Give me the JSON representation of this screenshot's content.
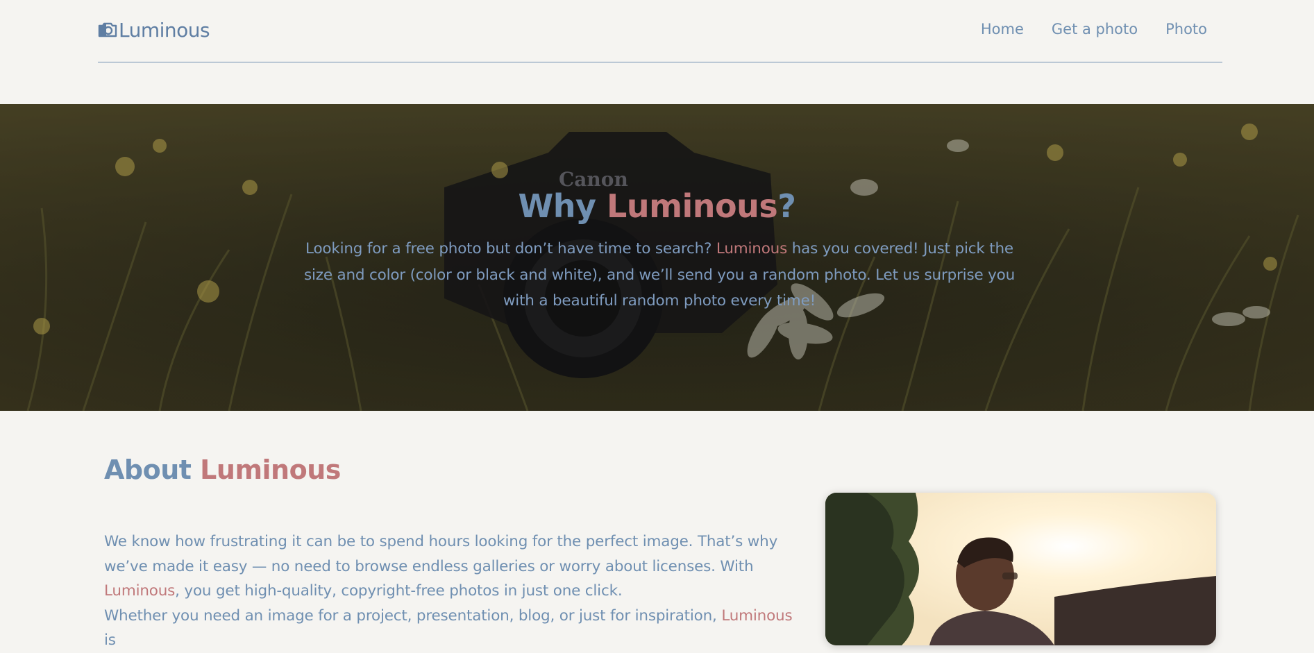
{
  "header": {
    "logo_text": "Luminous",
    "logo_icon": "camera-icon",
    "nav": [
      {
        "label": "Home"
      },
      {
        "label": "Get a photo"
      },
      {
        "label": "Photo"
      }
    ]
  },
  "hero": {
    "title_prefix": "Why ",
    "title_brand": "Luminous",
    "title_suffix": "?",
    "text_part1": "Looking for a free photo but don’t have time to search? ",
    "text_brand": "Luminous",
    "text_part2": " has you covered! Just pick the size and color (color or black and white), and we’ll send you a random photo. Let us surprise you with a beautiful random photo every time!"
  },
  "about": {
    "title_prefix": "About ",
    "title_brand": "Luminous",
    "para1_part1": "We know how frustrating it can be to spend hours looking for the perfect image. That’s why we’ve made it easy — no need to browse endless galleries or worry about licenses. With ",
    "para1_brand": "Luminous",
    "para1_part2": ", you get high-quality, copyright-free photos in just one click.",
    "para2_part1": "Whether you need an image for a project, presentation, blog, or just for inspiration, ",
    "para2_brand": "Luminous",
    "para2_part2": " is"
  },
  "colors": {
    "primary": "#6f8fb1",
    "accent": "#c0787a",
    "background": "#f5f4f1"
  }
}
